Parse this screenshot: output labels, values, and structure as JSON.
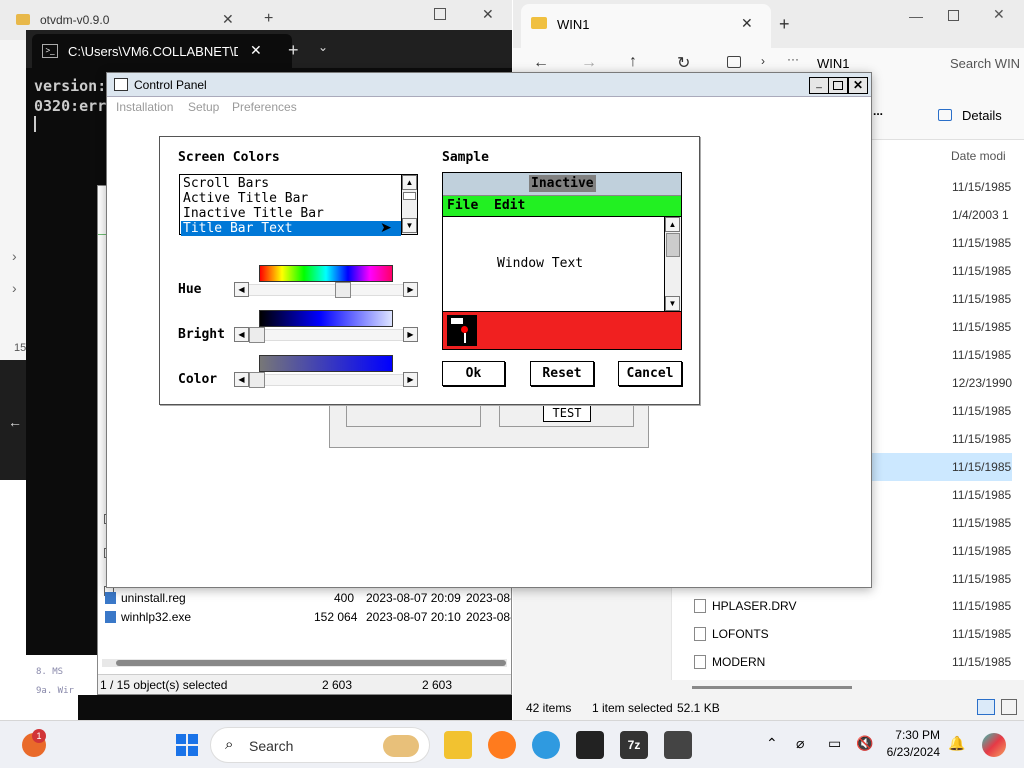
{
  "otvdm": {
    "tab_title": "otvdm-v0.9.0"
  },
  "console": {
    "tab_title": "C:\\Users\\VM6.COLLABNET\\Dc",
    "lines": [
      "version:",
      "0320:err"
    ],
    "bottom_lines": [
      "8. MS",
      "9a. Wir"
    ],
    "left_num": "15"
  },
  "explorer": {
    "tab_title": "WIN1",
    "address": "WIN1",
    "search_placeholder": "Search WIN",
    "details_label": "Details",
    "more": "...",
    "col_date": "Date modi",
    "dates": [
      "11/15/1985",
      "1/4/2003 1",
      "11/15/1985",
      "11/15/1985",
      "11/15/1985",
      "11/15/1985",
      "11/15/1985",
      "12/23/1990",
      "11/15/1985",
      "11/15/1985",
      "11/15/1985",
      "11/15/1985",
      "11/15/1985",
      "11/15/1985",
      "11/15/1985",
      "11/15/1985",
      "11/15/1985"
    ],
    "named_files": [
      {
        "name": "HPLASER.DRV",
        "date": "11/15/1985"
      },
      {
        "name": "LOFONTS",
        "date": "11/15/1985"
      },
      {
        "name": "MODERN",
        "date": "11/15/1985"
      }
    ],
    "status_items": "42 items",
    "status_selected": "1 item selected",
    "status_size": "52.1 KB"
  },
  "winfile": {
    "rows": [
      {
        "name": "uninstall.reg",
        "size": "400",
        "date": "2023-08-07 20:09",
        "date2": "2023-08-"
      },
      {
        "name": "winhlp32.exe",
        "size": "152 064",
        "date": "2023-08-07 20:10",
        "date2": "2023-08-"
      }
    ],
    "status": "1 / 15 object(s) selected",
    "status_a": "2 603",
    "status_b": "2 603"
  },
  "control_panel": {
    "title": "Control Panel",
    "menu": [
      "Installation",
      "Setup",
      "Preferences"
    ],
    "behind_test": "TEST"
  },
  "dialog": {
    "screen_colors_label": "Screen Colors",
    "sample_label": "Sample",
    "color_items": [
      "Scroll Bars",
      "Active Title Bar",
      "Inactive Title Bar",
      "Title Bar Text"
    ],
    "selected_item": "Title Bar Text",
    "hue_label": "Hue",
    "bright_label": "Bright",
    "color_label": "Color",
    "hue_level": 0.62,
    "bright_level": 0.0,
    "color_level": 0.0,
    "sample_inactive": "Inactive",
    "sample_menu": [
      "File",
      "Edit"
    ],
    "sample_window_text": "Window Text",
    "ok": "Ok",
    "reset": "Reset",
    "cancel": "Cancel",
    "colors": {
      "menu_bar": "#22f022",
      "desktop": "#f02020",
      "selection": "#0078d7",
      "inactive_bg": "#c0d0dc",
      "inactive_caption": "#808080"
    }
  },
  "taskbar": {
    "search": "Search",
    "time": "7:30 PM",
    "date": "6/23/2024",
    "badge": "1"
  }
}
